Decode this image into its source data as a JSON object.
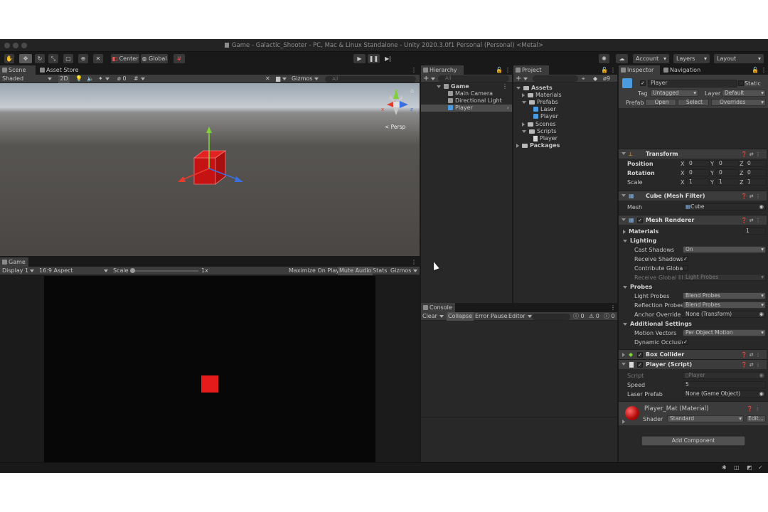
{
  "window": {
    "title": "Game - Galactic_Shooter - PC, Mac & Linux Standalone - Unity 2020.3.0f1 Personal (Personal) <Metal>"
  },
  "toolbar": {
    "pivot_label": "Center",
    "space_label": "Global",
    "account_label": "Account",
    "layers_label": "Layers",
    "layout_label": "Layout"
  },
  "scene": {
    "tabs": [
      "Scene",
      "Asset Store"
    ],
    "shading_mode": "Shaded",
    "mode_2d": "2D",
    "hidden_count": "0",
    "gizmos_label": "Gizmos",
    "search_placeholder": "All",
    "persp_label": "< Persp",
    "axis_x": "x",
    "axis_z": "z",
    "axis_y": "y"
  },
  "game": {
    "tab": "Game",
    "display": "Display 1",
    "aspect": "16:9 Aspect",
    "scale_label": "Scale",
    "scale_value": "1x",
    "maximize_label": "Maximize On Play",
    "mute_label": "Mute Audio",
    "stats_label": "Stats",
    "gizmos_label": "Gizmos"
  },
  "hierarchy": {
    "tab": "Hierarchy",
    "search_placeholder": "All",
    "items": [
      {
        "label": "Game"
      },
      {
        "label": "Main Camera"
      },
      {
        "label": "Directional Light"
      },
      {
        "label": "Player"
      }
    ]
  },
  "project": {
    "tab": "Project",
    "hidden_count": "9",
    "items": [
      {
        "label": "Assets"
      },
      {
        "label": "Materials"
      },
      {
        "label": "Prefabs"
      },
      {
        "label": "Laser"
      },
      {
        "label": "Player"
      },
      {
        "label": "Scenes"
      },
      {
        "label": "Scripts"
      },
      {
        "label": "Player"
      },
      {
        "label": "Packages"
      }
    ]
  },
  "console": {
    "tab": "Console",
    "clear_label": "Clear",
    "collapse_label": "Collapse",
    "error_pause_label": "Error Pause",
    "editor_label": "Editor",
    "log_count": "0",
    "warn_count": "0",
    "error_count": "0"
  },
  "inspector": {
    "tabs": [
      "Inspector",
      "Navigation"
    ],
    "object_name": "Player",
    "static_label": "Static",
    "tag_label": "Tag",
    "tag_value": "Untagged",
    "layer_label": "Layer",
    "layer_value": "Default",
    "prefab_label": "Prefab",
    "open_label": "Open",
    "select_label": "Select",
    "overrides_label": "Overrides",
    "transform": {
      "title": "Transform",
      "position_label": "Position",
      "rotation_label": "Rotation",
      "scale_label": "Scale",
      "position": {
        "x": "0",
        "y": "0",
        "z": "0"
      },
      "rotation": {
        "x": "0",
        "y": "0",
        "z": "0"
      },
      "scale": {
        "x": "1",
        "y": "1",
        "z": "1"
      },
      "x": "X",
      "y": "Y",
      "z": "Z"
    },
    "mesh_filter": {
      "title": "Cube (Mesh Filter)",
      "mesh_label": "Mesh",
      "mesh_value": "Cube"
    },
    "mesh_renderer": {
      "title": "Mesh Renderer",
      "materials_label": "Materials",
      "materials_count": "1",
      "lighting_label": "Lighting",
      "cast_shadows_label": "Cast Shadows",
      "cast_shadows_value": "On",
      "receive_shadows_label": "Receive Shadows",
      "contribute_gi_label": "Contribute Global I",
      "receive_gi_label": "Receive Global Illu",
      "receive_gi_value": "Light Probes",
      "probes_label": "Probes",
      "light_probes_label": "Light Probes",
      "light_probes_value": "Blend Probes",
      "reflection_probes_label": "Reflection Probes",
      "reflection_probes_value": "Blend Probes",
      "anchor_override_label": "Anchor Override",
      "anchor_override_value": "None (Transform)",
      "additional_label": "Additional Settings",
      "motion_vectors_label": "Motion Vectors",
      "motion_vectors_value": "Per Object Motion",
      "dynamic_occlusion_label": "Dynamic Occlusio"
    },
    "box_collider": {
      "title": "Box Collider"
    },
    "player_script": {
      "title": "Player (Script)",
      "script_label": "Script",
      "script_value": "Player",
      "speed_label": "Speed",
      "speed_value": "5",
      "laser_prefab_label": "Laser Prefab",
      "laser_prefab_value": "None (Game Object)"
    },
    "material": {
      "title": "Player_Mat (Material)",
      "shader_label": "Shader",
      "shader_value": "Standard",
      "edit_label": "Edit..."
    },
    "add_component_label": "Add Component"
  },
  "colors": {
    "cube_red": "#e31b1b",
    "selection_blue": "#2c5d87",
    "gizmo_red": "#e53b2e",
    "gizmo_green": "#7fd13b",
    "gizmo_blue": "#3b6fe0"
  },
  "icons": [
    "hand-icon",
    "move-icon",
    "rotate-icon",
    "scale-icon",
    "rect-icon",
    "transform-icon",
    "play-icon",
    "pause-icon",
    "step-icon",
    "cloud-icon",
    "collab-icon",
    "lock-icon",
    "menu-icon",
    "help-icon",
    "settings-icon"
  ]
}
